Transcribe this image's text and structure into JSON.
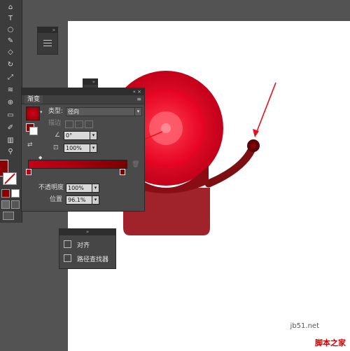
{
  "colors": {
    "accent": "#8b0000",
    "bell_red": "#d4001f",
    "bell_base": "#9b1c24",
    "arrow": "#e8101c"
  },
  "toolbar": {
    "icons": [
      "selection-icon",
      "pen-icon",
      "type-icon",
      "ellipse-icon",
      "brush-icon",
      "pencil-icon",
      "eraser-icon",
      "rotate-icon",
      "scale-icon",
      "warp-icon",
      "free-transform-icon",
      "shape-builder-icon",
      "gradient-icon",
      "eyedropper-icon",
      "symbol-sprayer-icon",
      "graph-icon",
      "artboard-icon",
      "slice-icon",
      "hand-icon",
      "zoom-icon"
    ],
    "text_tool": "T"
  },
  "gradient_panel": {
    "tab_title": "渐变",
    "collapse_glyph": "«",
    "close_glyph": "×",
    "type_label": "类型:",
    "type_value": "径向",
    "stroke_label": "描边",
    "angle_value": "0°",
    "aspect_value": "100%",
    "opacity_label": "不透明度",
    "opacity_value": "100%",
    "location_label": "位置",
    "location_value": "96.1%"
  },
  "align_panel": {
    "items": [
      {
        "icon": "align-icon",
        "label": "对齐"
      },
      {
        "icon": "pathfinder-icon",
        "label": "路径查找器"
      }
    ]
  },
  "watermark": {
    "url": "jb51.net",
    "text": "脚本之家"
  }
}
